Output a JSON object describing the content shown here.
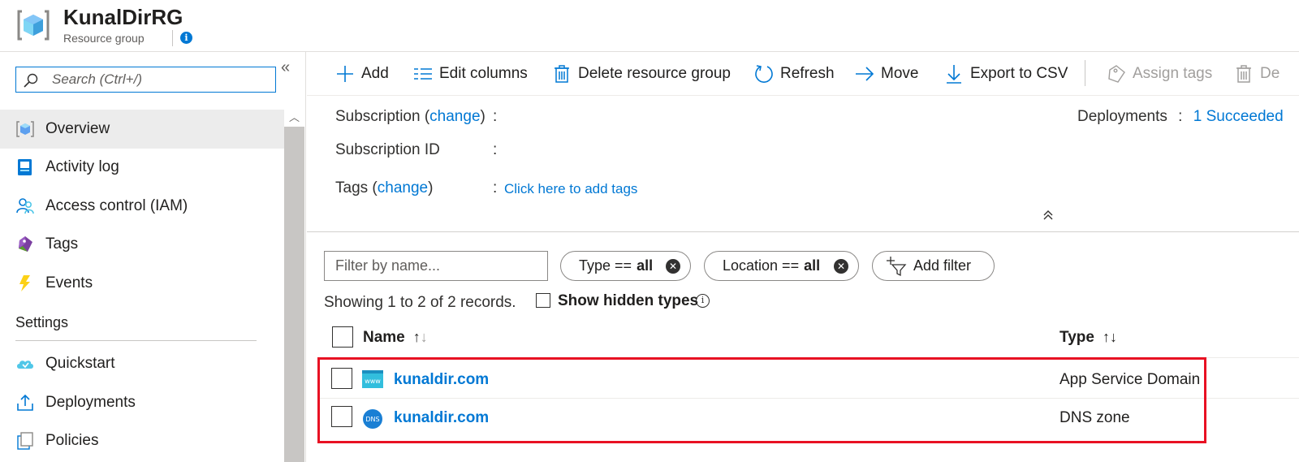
{
  "header": {
    "title": "KunalDirRG",
    "subtitle": "Resource group",
    "info_icon": "i"
  },
  "sidebar": {
    "search_placeholder": "Search (Ctrl+/)",
    "collapse_glyph": "«",
    "items": [
      {
        "label": "Overview",
        "icon": "overview-icon"
      },
      {
        "label": "Activity log",
        "icon": "activity-log-icon"
      },
      {
        "label": "Access control (IAM)",
        "icon": "iam-icon"
      },
      {
        "label": "Tags",
        "icon": "tag-icon"
      },
      {
        "label": "Events",
        "icon": "lightning-icon"
      }
    ],
    "section_settings": "Settings",
    "settings_items": [
      {
        "label": "Quickstart",
        "icon": "cloud-icon"
      },
      {
        "label": "Deployments",
        "icon": "upload-icon"
      },
      {
        "label": "Policies",
        "icon": "policies-icon"
      }
    ]
  },
  "toolbar": {
    "add": "Add",
    "edit_columns": "Edit columns",
    "delete_rg": "Delete resource group",
    "refresh": "Refresh",
    "move": "Move",
    "export_csv": "Export to CSV",
    "assign_tags": "Assign tags",
    "delete_partial": "De"
  },
  "essentials": {
    "subscription_label": "Subscription",
    "change": "change",
    "subscription_id_label": "Subscription ID",
    "tags_label": "Tags",
    "add_tags_link": "Click here to add tags",
    "deployments_label": "Deployments",
    "deployments_value": "1 Succeeded",
    "colon": ":"
  },
  "filters": {
    "name_placeholder": "Filter by name...",
    "type_pill": "Type ==",
    "type_value": "all",
    "location_pill": "Location ==",
    "location_value": "all",
    "add_filter": "Add filter",
    "records_text": "Showing 1 to 2 of 2 records.",
    "show_hidden_types": "Show hidden types"
  },
  "table": {
    "col_name": "Name",
    "col_type": "Type",
    "sort_up": "↑",
    "sort_down": "↓",
    "rows": [
      {
        "name": "kunaldir.com",
        "type": "App Service Domain",
        "icon": "www-icon",
        "icon_text": "www"
      },
      {
        "name": "kunaldir.com",
        "type": "DNS zone",
        "icon": "dns-icon",
        "icon_text": "DNS"
      }
    ]
  },
  "colors": {
    "accent": "#0078d4",
    "highlight": "#e81123"
  }
}
